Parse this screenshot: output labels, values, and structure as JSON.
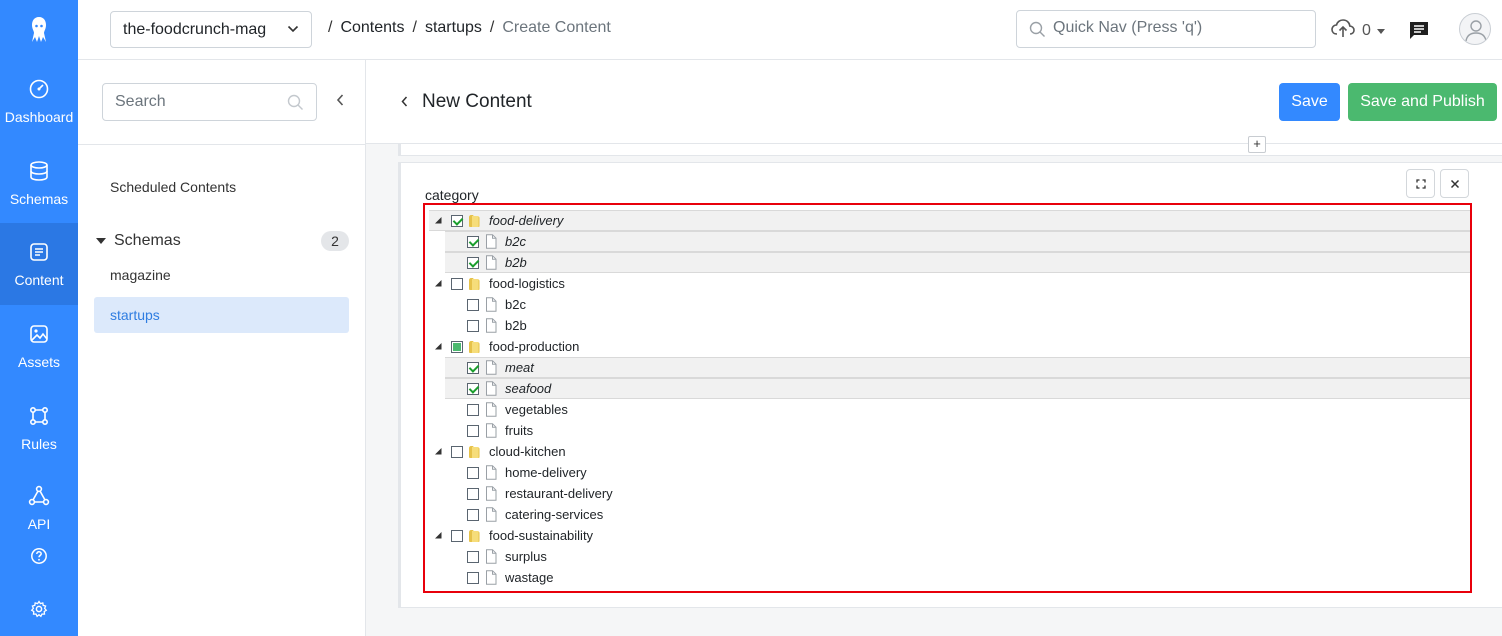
{
  "nav": {
    "items": [
      {
        "label": "Dashboard",
        "icon": "dashboard-gauge-icon"
      },
      {
        "label": "Schemas",
        "icon": "database-icon"
      },
      {
        "label": "Content",
        "icon": "content-icon"
      },
      {
        "label": "Assets",
        "icon": "image-icon"
      },
      {
        "label": "Rules",
        "icon": "rules-icon"
      },
      {
        "label": "API",
        "icon": "api-icon"
      }
    ],
    "active": "Content"
  },
  "topbar": {
    "app_name": "the-foodcrunch-mag",
    "breadcrumb": {
      "contents": "Contents",
      "schema": "startups",
      "current": "Create Content",
      "separator": "/"
    },
    "quicknav_placeholder": "Quick Nav (Press 'q')",
    "upload_count": "0"
  },
  "sidebar": {
    "search_placeholder": "Search",
    "scheduled": "Scheduled Contents",
    "schemas_label": "Schemas",
    "schemas_count": "2",
    "schemas": [
      {
        "label": "magazine",
        "active": false
      },
      {
        "label": "startups",
        "active": true
      }
    ]
  },
  "editor": {
    "title": "New Content",
    "save_label": "Save",
    "publish_label": "Save and Publish",
    "add_label": "+",
    "field_label": "category"
  },
  "tree": [
    {
      "label": "food-delivery",
      "level": 0,
      "checked": "checked",
      "selected": true
    },
    {
      "label": "b2c",
      "level": 1,
      "checked": "checked",
      "selected": true
    },
    {
      "label": "b2b",
      "level": 1,
      "checked": "checked",
      "selected": true
    },
    {
      "label": "food-logistics",
      "level": 0,
      "checked": "unchecked",
      "selected": false
    },
    {
      "label": "b2c",
      "level": 1,
      "checked": "unchecked",
      "selected": false
    },
    {
      "label": "b2b",
      "level": 1,
      "checked": "unchecked",
      "selected": false
    },
    {
      "label": "food-production",
      "level": 0,
      "checked": "partial",
      "selected": false
    },
    {
      "label": "meat",
      "level": 1,
      "checked": "checked",
      "selected": true
    },
    {
      "label": "seafood",
      "level": 1,
      "checked": "checked",
      "selected": true
    },
    {
      "label": "vegetables",
      "level": 1,
      "checked": "unchecked",
      "selected": false
    },
    {
      "label": "fruits",
      "level": 1,
      "checked": "unchecked",
      "selected": false
    },
    {
      "label": "cloud-kitchen",
      "level": 0,
      "checked": "unchecked",
      "selected": false
    },
    {
      "label": "home-delivery",
      "level": 1,
      "checked": "unchecked",
      "selected": false
    },
    {
      "label": "restaurant-delivery",
      "level": 1,
      "checked": "unchecked",
      "selected": false
    },
    {
      "label": "catering-services",
      "level": 1,
      "checked": "unchecked",
      "selected": false
    },
    {
      "label": "food-sustainability",
      "level": 0,
      "checked": "unchecked",
      "selected": false
    },
    {
      "label": "surplus",
      "level": 1,
      "checked": "unchecked",
      "selected": false
    },
    {
      "label": "wastage",
      "level": 1,
      "checked": "unchecked",
      "selected": false
    }
  ],
  "colors": {
    "rail": "#3389ff",
    "rail_active": "#2b78e4",
    "save": "#3389ff",
    "publish": "#4bb96f",
    "highlight_border": "#e8000b",
    "check": "#1a9e2d"
  }
}
